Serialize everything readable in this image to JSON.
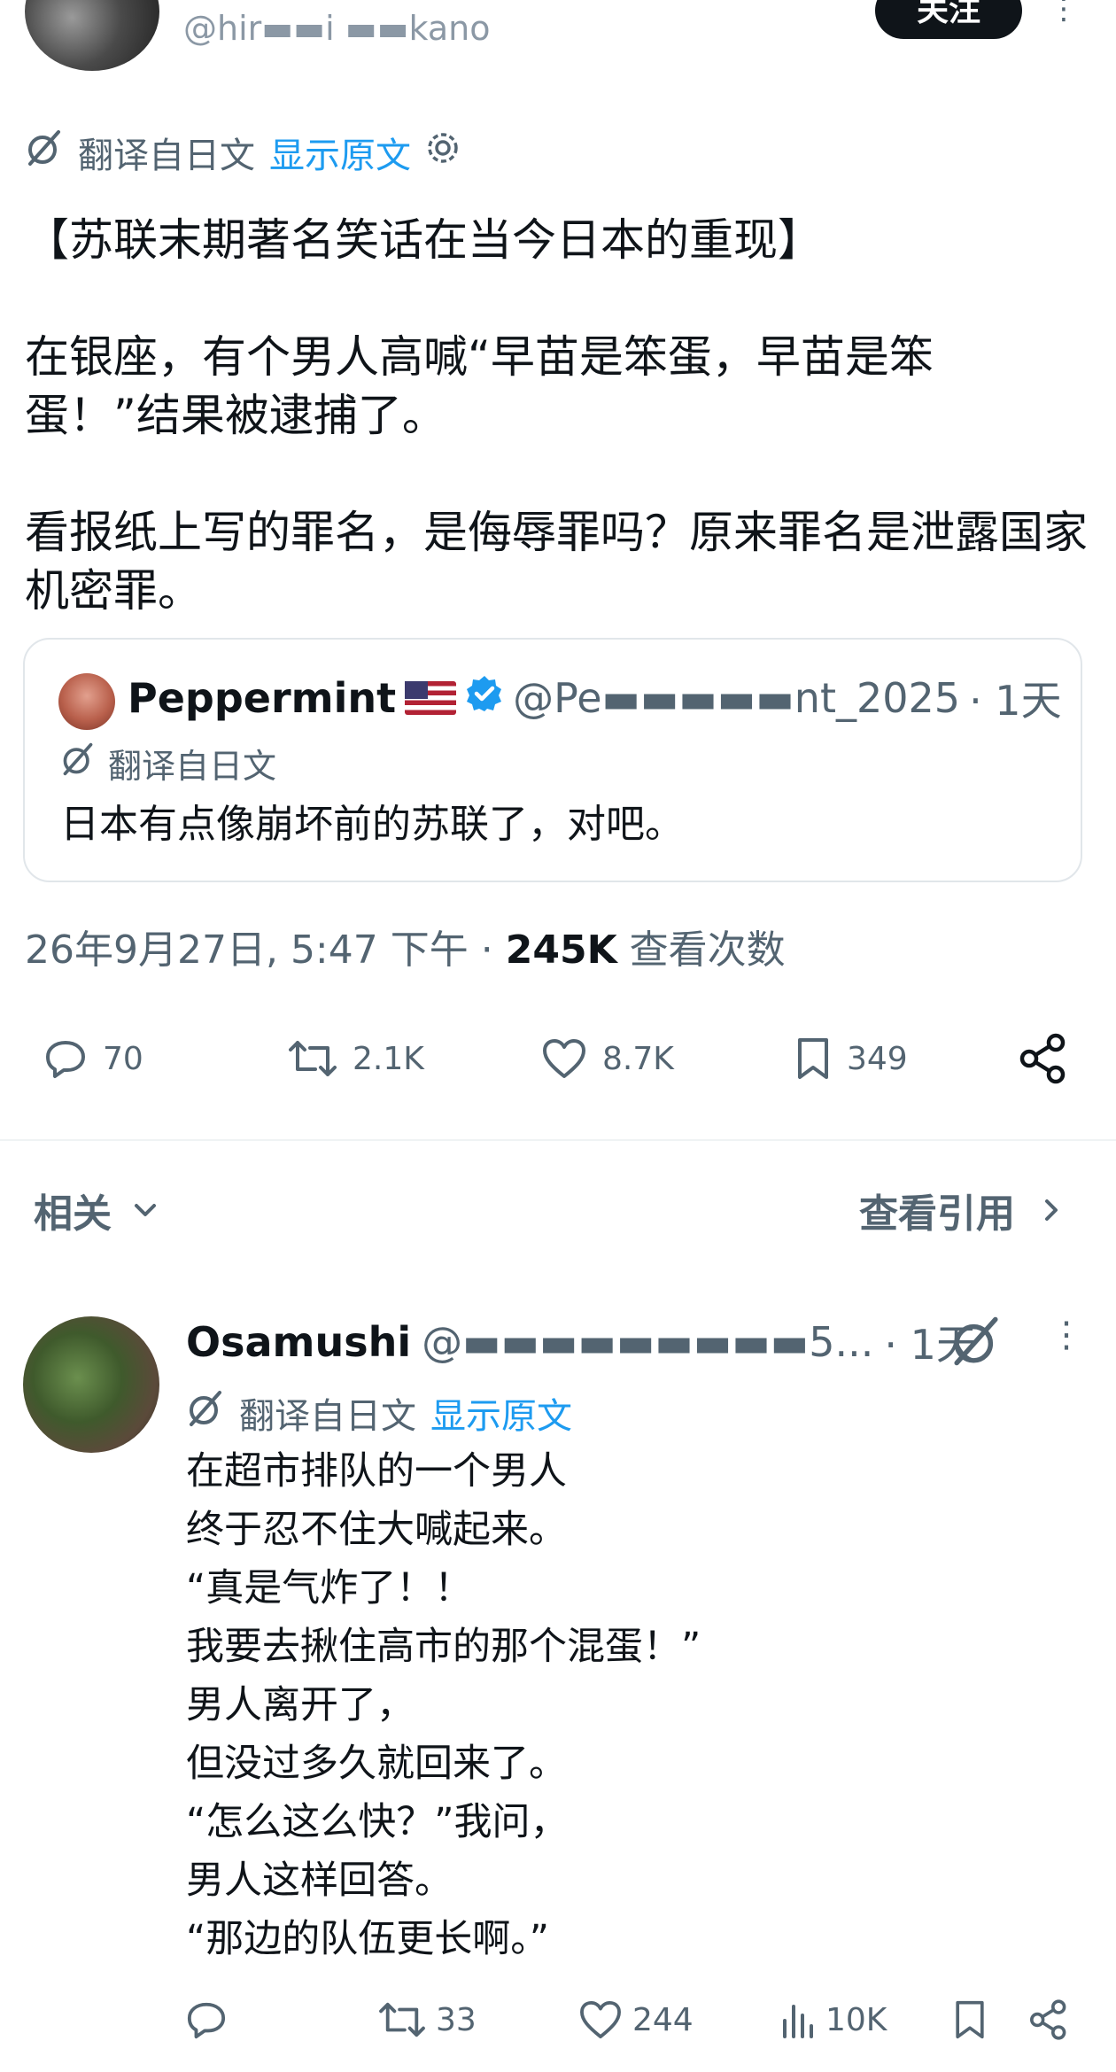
{
  "header": {
    "handle": "@hir▬▬i ▬▬kano",
    "follow_label": "关注",
    "more_icon": "⋮"
  },
  "post": {
    "translate_label": "翻译自日文",
    "show_original_label": "显示原文",
    "text": "【苏联末期著名笑话在当今日本的重现】\n\n在银座，有个男人高喊“早苗是笨蛋，早苗是笨蛋！”结果被逮捕了。\n\n看报纸上写的罪名，是侮辱罪吗？原来罪名是泄露国家机密罪。",
    "quote": {
      "name": "Peppermint",
      "handle": "@Pe▬▬▬▬▬nt_2025",
      "time": "· 1天",
      "translate_label": "翻译自日文",
      "text": "日本有点像崩坏前的苏联了，对吧。"
    },
    "meta": {
      "timestamp": "26年9月27日, 5:47 下午 ·",
      "views": "245K",
      "views_label": "查看次数"
    },
    "actions": {
      "replies": "70",
      "reposts": "2.1K",
      "likes": "8.7K",
      "bookmarks": "349"
    }
  },
  "related_label": "相关",
  "view_quotes_label": "查看引用",
  "reply": {
    "name": "Osamushi",
    "handle": "@▬▬▬▬▬▬▬▬▬5...",
    "time": "· 1天",
    "translate_label": "翻译自日文",
    "show_original_label": "显示原文",
    "text": "在超市排队的一个男人\n终于忍不住大喊起来。\n“真是气炸了！！\n我要去揪住高市的那个混蛋！”\n男人离开了，\n但没过多久就回来了。\n“怎么这么快？”我问，\n男人这样回答。\n“那边的队伍更长啊。”",
    "actions": {
      "reposts": "33",
      "likes": "244",
      "views": "10K"
    }
  },
  "colors": {
    "link": "#1d9bf0",
    "muted": "#536471",
    "verified": "#1d9bf0",
    "text": "#0f1419"
  }
}
